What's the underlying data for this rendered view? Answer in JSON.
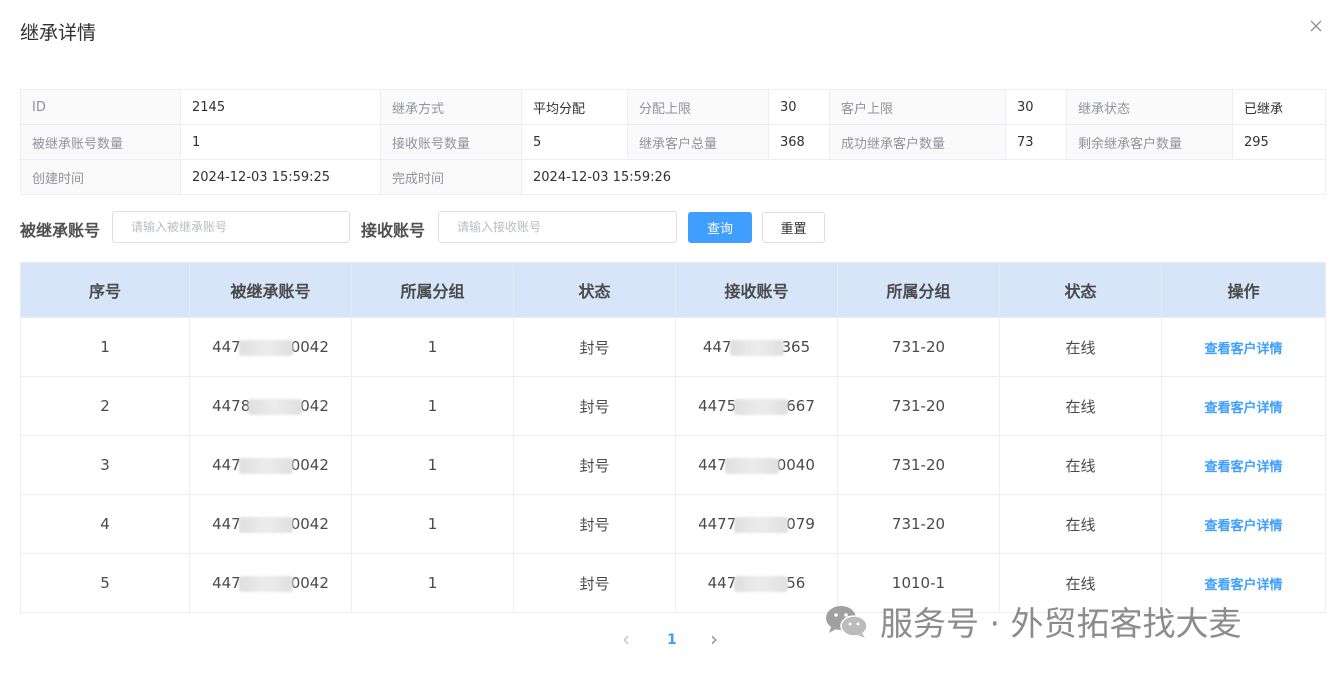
{
  "dialog": {
    "title": "继承详情"
  },
  "info": {
    "rows": [
      [
        {
          "label": "ID",
          "value": "2145"
        },
        {
          "label": "继承方式",
          "value": "平均分配"
        },
        {
          "label": "分配上限",
          "value": "30"
        },
        {
          "label": "客户上限",
          "value": "30"
        },
        {
          "label": "继承状态",
          "value": "已继承"
        }
      ],
      [
        {
          "label": "被继承账号数量",
          "value": "1"
        },
        {
          "label": "接收账号数量",
          "value": "5"
        },
        {
          "label": "继承客户总量",
          "value": "368"
        },
        {
          "label": "成功继承客户数量",
          "value": "73"
        },
        {
          "label": "剩余继承客户数量",
          "value": "295"
        }
      ],
      [
        {
          "label": "创建时间",
          "value": "2024-12-03 15:59:25"
        },
        {
          "label": "完成时间",
          "value": "2024-12-03 15:59:26"
        }
      ]
    ]
  },
  "search": {
    "inherited_label": "被继承账号",
    "inherited_placeholder": "请输入被继承账号",
    "receiver_label": "接收账号",
    "receiver_placeholder": "请输入接收账号",
    "query_button": "查询",
    "reset_button": "重置"
  },
  "table": {
    "columns": [
      "序号",
      "被继承账号",
      "所属分组",
      "状态",
      "接收账号",
      "所属分组",
      "状态",
      "操作"
    ],
    "rows": [
      {
        "index": "1",
        "from_prefix": "447",
        "from_suffix": "0042",
        "from_group": "1",
        "from_status": "封号",
        "to_prefix": "447",
        "to_suffix": "365",
        "to_group": "731-20",
        "to_status": "在线",
        "action": "查看客户详情"
      },
      {
        "index": "2",
        "from_prefix": "4478",
        "from_suffix": "042",
        "from_group": "1",
        "from_status": "封号",
        "to_prefix": "4475",
        "to_suffix": "667",
        "to_group": "731-20",
        "to_status": "在线",
        "action": "查看客户详情"
      },
      {
        "index": "3",
        "from_prefix": "447",
        "from_suffix": "0042",
        "from_group": "1",
        "from_status": "封号",
        "to_prefix": "447",
        "to_suffix": "0040",
        "to_group": "731-20",
        "to_status": "在线",
        "action": "查看客户详情"
      },
      {
        "index": "4",
        "from_prefix": "447",
        "from_suffix": "0042",
        "from_group": "1",
        "from_status": "封号",
        "to_prefix": "4477",
        "to_suffix": "079",
        "to_group": "731-20",
        "to_status": "在线",
        "action": "查看客户详情"
      },
      {
        "index": "5",
        "from_prefix": "447",
        "from_suffix": "0042",
        "from_group": "1",
        "from_status": "封号",
        "to_prefix": "447",
        "to_suffix": "56",
        "to_group": "1010-1",
        "to_status": "在线",
        "action": "查看客户详情"
      }
    ]
  },
  "pagination": {
    "prev": "‹",
    "current": "1",
    "next": "›"
  },
  "watermark": {
    "text": "服务号 · 外贸拓客找大麦"
  },
  "colors": {
    "primary": "#409eff",
    "header_bg": "#d6e5f7"
  }
}
